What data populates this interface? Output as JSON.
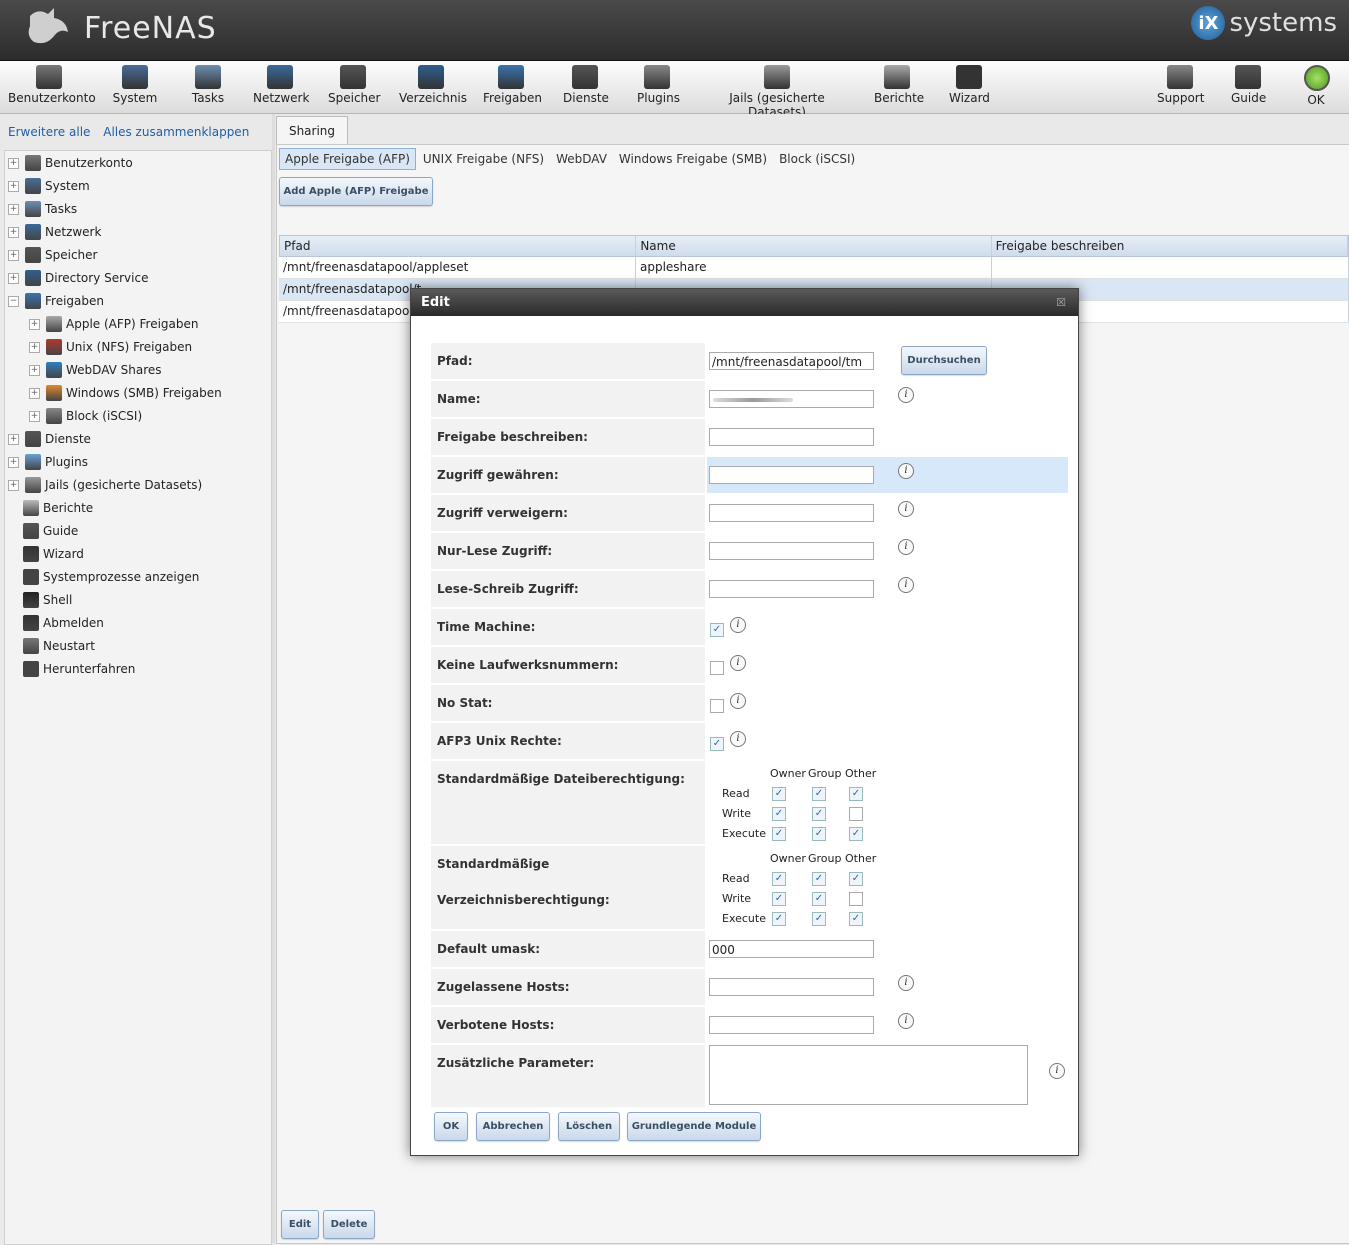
{
  "header": {
    "brand": "FreeNAS",
    "vendor_badge": "iX",
    "vendor_text": "systems"
  },
  "toolbar": [
    {
      "label": "Benutzerkonto",
      "icon": "users-icon",
      "color": "#777"
    },
    {
      "label": "System",
      "icon": "system-chart-icon",
      "color": "#4a6d99"
    },
    {
      "label": "Tasks",
      "icon": "clock-icon",
      "color": "#6d8fb3"
    },
    {
      "label": "Netzwerk",
      "icon": "network-icon",
      "color": "#3a6a9c"
    },
    {
      "label": "Speicher",
      "icon": "folder-icon",
      "color": "#555"
    },
    {
      "label": "Verzeichnis",
      "icon": "directory-icon",
      "color": "#2d5f8f"
    },
    {
      "label": "Freigaben",
      "icon": "sharing-icon",
      "color": "#3a74b0"
    },
    {
      "label": "Dienste",
      "icon": "gears-icon",
      "color": "#555"
    },
    {
      "label": "Plugins",
      "icon": "plugins-icon",
      "color": "#888"
    },
    {
      "label": "Jails (gesicherte Datasets)",
      "icon": "jails-icon",
      "color": "#999"
    },
    {
      "label": "Berichte",
      "icon": "reports-icon",
      "color": "#aaa"
    },
    {
      "label": "Wizard",
      "icon": "wizard-hat-icon",
      "color": "#333"
    },
    {
      "label": "Support",
      "icon": "support-icon",
      "color": "#888"
    },
    {
      "label": "Guide",
      "icon": "guide-icon",
      "color": "#555"
    },
    {
      "label": "OK",
      "icon": "status-ok-icon",
      "color": "#7ac943"
    }
  ],
  "left": {
    "expand_all": "Erweitere alle",
    "collapse_all": "Alles zusammenklappen",
    "tree": [
      {
        "label": "Benutzerkonto",
        "level": 0,
        "pm": "+"
      },
      {
        "label": "System",
        "level": 0,
        "pm": "+"
      },
      {
        "label": "Tasks",
        "level": 0,
        "pm": "+"
      },
      {
        "label": "Netzwerk",
        "level": 0,
        "pm": "+"
      },
      {
        "label": "Speicher",
        "level": 0,
        "pm": "+"
      },
      {
        "label": "Directory Service",
        "level": 0,
        "pm": "+"
      },
      {
        "label": "Freigaben",
        "level": 0,
        "pm": "−"
      },
      {
        "label": "Apple (AFP) Freigaben",
        "level": 1,
        "pm": "+"
      },
      {
        "label": "Unix (NFS) Freigaben",
        "level": 1,
        "pm": "+"
      },
      {
        "label": "WebDAV Shares",
        "level": 1,
        "pm": "+"
      },
      {
        "label": "Windows (SMB) Freigaben",
        "level": 1,
        "pm": "+"
      },
      {
        "label": "Block (iSCSI)",
        "level": 1,
        "pm": "+"
      },
      {
        "label": "Dienste",
        "level": 0,
        "pm": "+"
      },
      {
        "label": "Plugins",
        "level": 0,
        "pm": "+"
      },
      {
        "label": "Jails (gesicherte Datasets)",
        "level": 0,
        "pm": "+"
      },
      {
        "label": "Berichte",
        "level": 0,
        "pm": ""
      },
      {
        "label": "Guide",
        "level": 0,
        "pm": ""
      },
      {
        "label": "Wizard",
        "level": 0,
        "pm": ""
      },
      {
        "label": "Systemprozesse anzeigen",
        "level": 0,
        "pm": ""
      },
      {
        "label": "Shell",
        "level": 0,
        "pm": ""
      },
      {
        "label": "Abmelden",
        "level": 0,
        "pm": ""
      },
      {
        "label": "Neustart",
        "level": 0,
        "pm": ""
      },
      {
        "label": "Herunterfahren",
        "level": 0,
        "pm": ""
      }
    ]
  },
  "main": {
    "tab": "Sharing",
    "subtabs": [
      "Apple Freigabe (AFP)",
      "UNIX Freigabe (NFS)",
      "WebDAV",
      "Windows Freigabe (SMB)",
      "Block (iSCSI)"
    ],
    "add_button": "Add Apple (AFP) Freigabe",
    "columns": [
      "Pfad",
      "Name",
      "Freigabe beschreiben"
    ],
    "rows": [
      [
        "/mnt/freenasdatapool/appleset",
        "appleshare",
        ""
      ],
      [
        "/mnt/freenasdatapool/t",
        "",
        ""
      ],
      [
        "/mnt/freenasdatapool/t",
        "",
        ""
      ]
    ],
    "edit_button": "Edit",
    "delete_button": "Delete"
  },
  "dialog": {
    "title": "Edit",
    "close": "☒",
    "browse": "Durchsuchen",
    "fields": {
      "pfad": {
        "label": "Pfad:",
        "value": "/mnt/freenasdatapool/tm"
      },
      "name": {
        "label": "Name:",
        "value": ""
      },
      "comment": {
        "label": "Freigabe beschreiben:",
        "value": ""
      },
      "allow": {
        "label": "Zugriff gewähren:",
        "value": ""
      },
      "deny": {
        "label": "Zugriff verweigern:",
        "value": ""
      },
      "ro": {
        "label": "Nur-Lese Zugriff:",
        "value": ""
      },
      "rw": {
        "label": "Lese-Schreib Zugriff:",
        "value": ""
      },
      "timemachine": {
        "label": "Time Machine:",
        "checked": true
      },
      "nodev": {
        "label": "Keine Laufwerksnummern:",
        "checked": false
      },
      "nostat": {
        "label": "No Stat:",
        "checked": false
      },
      "upriv": {
        "label": "AFP3 Unix Rechte:",
        "checked": true
      },
      "fperm": {
        "label": "Standardmäßige Dateiberechtigung:"
      },
      "dperm": {
        "label": "Standardmäßige Verzeichnisberechtigung:"
      },
      "umask": {
        "label": "Default umask:",
        "value": "000"
      },
      "hostsallow": {
        "label": "Zugelassene Hosts:",
        "value": ""
      },
      "hostsdeny": {
        "label": "Verbotene Hosts:",
        "value": ""
      },
      "aux": {
        "label": "Zusätzliche Parameter:",
        "value": ""
      }
    },
    "perm_cols": [
      "Owner",
      "Group",
      "Other"
    ],
    "perm_rows": [
      "Read",
      "Write",
      "Execute"
    ],
    "file_perm": [
      [
        true,
        true,
        true
      ],
      [
        true,
        true,
        false
      ],
      [
        true,
        true,
        true
      ]
    ],
    "dir_perm": [
      [
        true,
        true,
        true
      ],
      [
        true,
        true,
        false
      ],
      [
        true,
        true,
        true
      ]
    ],
    "buttons": [
      "OK",
      "Abbrechen",
      "Löschen",
      "Grundlegende Module"
    ]
  }
}
